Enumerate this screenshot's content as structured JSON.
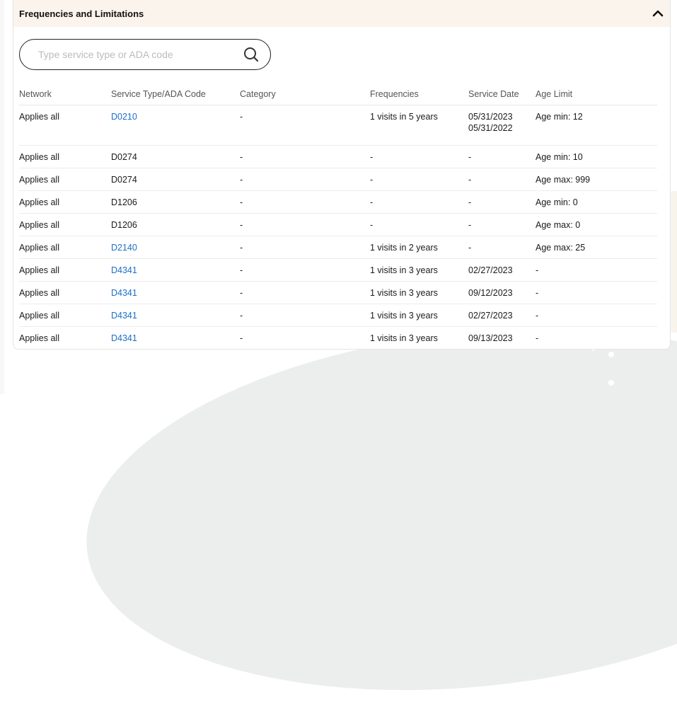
{
  "panel": {
    "title": "Frequencies and Limitations",
    "collapse_icon": "chevron-up-icon"
  },
  "search": {
    "placeholder": "Type service type or ADA code",
    "icon": "search-icon"
  },
  "table": {
    "headers": [
      "Network",
      "Service Type/ADA Code",
      "Category",
      "Frequencies",
      "Service Date",
      "Age Limit"
    ],
    "rows": [
      {
        "network": "Applies all",
        "code": "D0210",
        "code_link": true,
        "category": "-",
        "frequency": "1 visits in 5 years",
        "service_date": "05/31/2023",
        "service_date_2": "05/31/2022",
        "age_limit": "Age min: 12"
      },
      {
        "network": "Applies all",
        "code": "D0274",
        "code_link": false,
        "category": "-",
        "frequency": "-",
        "service_date": "-",
        "age_limit": "Age min: 10"
      },
      {
        "network": "Applies all",
        "code": "D0274",
        "code_link": false,
        "category": "-",
        "frequency": "-",
        "service_date": "-",
        "age_limit": "Age max: 999"
      },
      {
        "network": "Applies all",
        "code": "D1206",
        "code_link": false,
        "category": "-",
        "frequency": "-",
        "service_date": "-",
        "age_limit": "Age min: 0"
      },
      {
        "network": "Applies all",
        "code": "D1206",
        "code_link": false,
        "category": "-",
        "frequency": "-",
        "service_date": "-",
        "age_limit": "Age max: 0"
      },
      {
        "network": "Applies all",
        "code": "D2140",
        "code_link": true,
        "category": "-",
        "frequency": "1 visits in 2 years",
        "service_date": "-",
        "age_limit": "Age max: 25"
      },
      {
        "network": "Applies all",
        "code": "D4341",
        "code_link": true,
        "category": "-",
        "frequency": "1 visits in 3 years",
        "service_date": "02/27/2023",
        "age_limit": "-"
      },
      {
        "network": "Applies all",
        "code": "D4341",
        "code_link": true,
        "category": "-",
        "frequency": "1 visits in 3 years",
        "service_date": "09/12/2023",
        "age_limit": "-"
      },
      {
        "network": "Applies all",
        "code": "D4341",
        "code_link": true,
        "category": "-",
        "frequency": "1 visits in 3 years",
        "service_date": "02/27/2023",
        "age_limit": "-"
      },
      {
        "network": "Applies all",
        "code": "D4341",
        "code_link": true,
        "category": "-",
        "frequency": "1 visits in 3 years",
        "service_date": "09/13/2023",
        "age_limit": "-"
      }
    ]
  },
  "colors": {
    "header_bg": "#fbf4ec",
    "link": "#1b6fc7",
    "border": "#e4e4e4"
  }
}
